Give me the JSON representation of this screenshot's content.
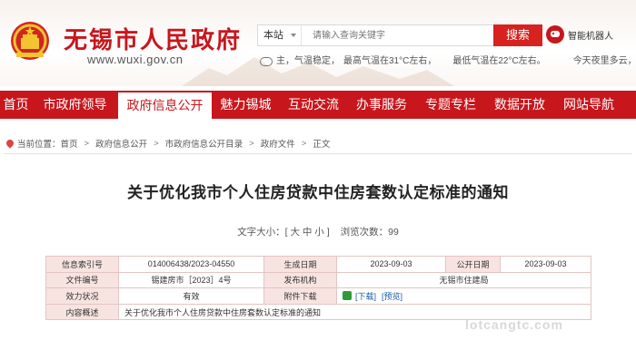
{
  "header": {
    "site_title": "无锡市人民政府",
    "site_url": "www.wuxi.gov.cn",
    "search": {
      "scope": "本站",
      "placeholder": "请输入查询关键字",
      "button_label": "搜索"
    },
    "robot_label": "智能机器人",
    "weather": {
      "part1": "主，气温稳定，",
      "part2": "最高气温在31°C左右，",
      "part3": "最低气温在22°C左右。",
      "part4": "今天夜里多云，局部有"
    }
  },
  "nav": {
    "items": [
      {
        "label": "首页"
      },
      {
        "label": "市政府领导"
      },
      {
        "label": "政府信息公开"
      },
      {
        "label": "魅力锡城"
      },
      {
        "label": "互动交流"
      },
      {
        "label": "办事服务"
      },
      {
        "label": "专题专栏"
      },
      {
        "label": "数据开放"
      },
      {
        "label": "网站导航"
      }
    ],
    "active_index": 2
  },
  "breadcrumb": {
    "prefix": "当前位置：",
    "items": [
      "首页",
      "政府信息公开",
      "市政府信息公开目录",
      "政府文件",
      "正文"
    ]
  },
  "article": {
    "title": "关于优化我市个人住房贷款中住房套数认定标准的通知",
    "font_size_label": "文字大小：",
    "font_size_options": "[ 大 中 小 ]",
    "views_label": "浏览次数：",
    "views_count": "99"
  },
  "info_table": {
    "index_no_label": "信息索引号",
    "index_no": "014006438/2023-04550",
    "created_label": "生成日期",
    "created": "2023-09-03",
    "published_label": "公开日期",
    "published": "2023-09-03",
    "doc_no_label": "文件编号",
    "doc_no": "锡建房市［2023］4号",
    "issuer_label": "发布机构",
    "issuer": "无锡市住建局",
    "status_label": "效力状况",
    "status": "有效",
    "attachment_label": "附件下载",
    "download_label": "[下载]",
    "preview_label": "[预览]",
    "summary_label": "内容概述",
    "summary": "关于优化我市个人住房贷款中住房套数认定标准的通知"
  },
  "watermark": "lotcangtc.com",
  "colors": {
    "brand_red": "#c8161d",
    "table_key_bg": "#f7e4e1",
    "link_blue": "#1a5aa8"
  }
}
